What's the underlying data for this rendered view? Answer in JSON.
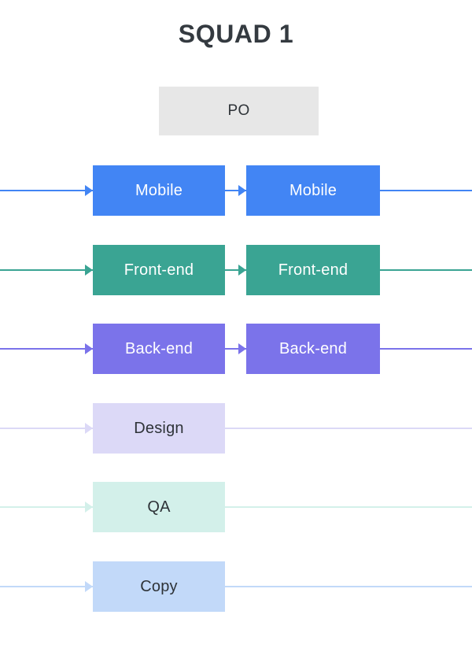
{
  "title": "SQUAD 1",
  "po": {
    "label": "PO",
    "fill": "#e7e7e7",
    "text_color": "#2e3338"
  },
  "colors": {
    "background": "#ffffff",
    "title_color": "#343a40"
  },
  "rows": [
    {
      "name": "mobile",
      "label": "Mobile",
      "second_label": "Mobile",
      "has_second_box": true,
      "fill": "#4285f4",
      "line_color": "#4285f4",
      "text_color": "#ffffff",
      "style": "solid"
    },
    {
      "name": "front-end",
      "label": "Front-end",
      "second_label": "Front-end",
      "has_second_box": true,
      "fill": "#3aa493",
      "line_color": "#3aa493",
      "text_color": "#ffffff",
      "style": "solid"
    },
    {
      "name": "back-end",
      "label": "Back-end",
      "second_label": "Back-end",
      "has_second_box": true,
      "fill": "#7b73ea",
      "line_color": "#7b73ea",
      "text_color": "#ffffff",
      "style": "solid"
    },
    {
      "name": "design",
      "label": "Design",
      "second_label": "",
      "has_second_box": false,
      "fill": "#dcd9f7",
      "line_color": "#dcd9f7",
      "text_color": "#2e3338",
      "style": "light"
    },
    {
      "name": "qa",
      "label": "QA",
      "second_label": "",
      "has_second_box": false,
      "fill": "#d3f0ea",
      "line_color": "#d3f0ea",
      "text_color": "#2e3338",
      "style": "light"
    },
    {
      "name": "copy",
      "label": "Copy",
      "second_label": "",
      "has_second_box": false,
      "fill": "#c2d9f9",
      "line_color": "#c2d9f9",
      "text_color": "#2e3338",
      "style": "light"
    }
  ]
}
